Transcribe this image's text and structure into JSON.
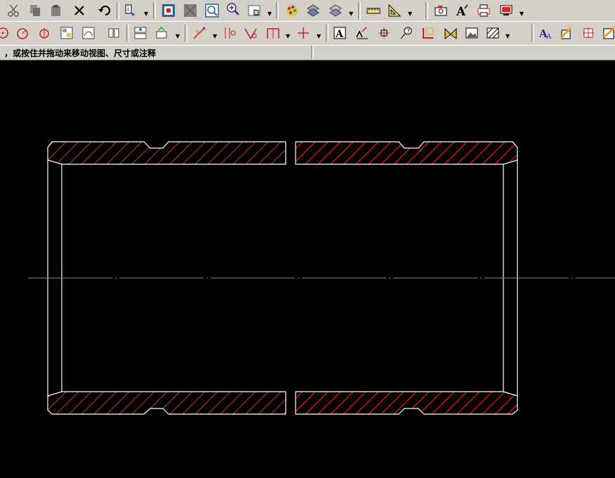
{
  "status_bar": {
    "prompt": "，或按住并拖动来移动视图、尺寸或注释"
  },
  "toolbar_top": {
    "buttons": [
      {
        "name": "cut-button",
        "icon": "scissors-icon"
      },
      {
        "name": "copy-button",
        "icon": "copy-icon"
      },
      {
        "name": "paste-button",
        "icon": "paste-icon"
      },
      {
        "name": "delete-button",
        "icon": "delete-x-icon"
      },
      {
        "name": "undo-button",
        "icon": "undo-arrow-icon"
      },
      {
        "name": "properties-button",
        "icon": "info-icon"
      },
      {
        "name": "zoom-fit-button",
        "icon": "zoom-fit-icon"
      },
      {
        "name": "zoom-window-button",
        "icon": "zoom-window-icon"
      },
      {
        "name": "zoom-box-button",
        "icon": "zoom-box-icon"
      },
      {
        "name": "zoom-inout-button",
        "icon": "magnifier-icon"
      },
      {
        "name": "pan-button",
        "icon": "pan-hand-icon"
      },
      {
        "name": "render-button",
        "icon": "palette-icon"
      },
      {
        "name": "layers-button",
        "icon": "layers-icon"
      },
      {
        "name": "layers-more-button",
        "icon": "layers-alt-icon"
      },
      {
        "name": "measure-button",
        "icon": "ruler-icon"
      },
      {
        "name": "triangle-ruler-button",
        "icon": "set-square-icon"
      },
      {
        "name": "snapshot-button",
        "icon": "camera-icon"
      },
      {
        "name": "text-style-button",
        "icon": "text-a-icon"
      },
      {
        "name": "printer-button",
        "icon": "printer-icon"
      },
      {
        "name": "display-button",
        "icon": "monitor-icon"
      }
    ]
  },
  "toolbar_bottom": {
    "buttons": [
      {
        "name": "circle-tool-button",
        "icon": "circle-arrow-icon"
      },
      {
        "name": "arc-tool-button",
        "icon": "arc-circle-icon"
      },
      {
        "name": "center-circle-button",
        "icon": "center-circle-icon"
      },
      {
        "name": "view-insert-button",
        "icon": "view-grid-icon"
      },
      {
        "name": "detail-view-button",
        "icon": "detail-view-icon"
      },
      {
        "name": "section-view-button",
        "icon": "section-view-icon"
      },
      {
        "name": "break-view-button",
        "icon": "break-view-icon"
      },
      {
        "name": "align-view-button",
        "icon": "align-view-icon"
      },
      {
        "name": "smart-dimension-button",
        "icon": "dimension-arrow-icon"
      },
      {
        "name": "ordinate-dimension-button",
        "icon": "ordinate-icon"
      },
      {
        "name": "angle-dimension-button",
        "icon": "angle-icon"
      },
      {
        "name": "chamfer-dimension-button",
        "icon": "chamfer-icon"
      },
      {
        "name": "centerline-button",
        "icon": "centerline-icon"
      },
      {
        "name": "note-button",
        "icon": "note-a-icon"
      },
      {
        "name": "surface-finish-button",
        "icon": "surface-finish-icon"
      },
      {
        "name": "datum-button",
        "icon": "datum-icon"
      },
      {
        "name": "balloon-button",
        "icon": "balloon-icon"
      },
      {
        "name": "geometric-tolerance-button",
        "icon": "gtol-icon"
      },
      {
        "name": "weld-symbol-button",
        "icon": "weld-icon"
      },
      {
        "name": "image-button",
        "icon": "image-icon"
      },
      {
        "name": "hatch-button",
        "icon": "hatch-icon"
      },
      {
        "name": "text-format-button",
        "icon": "text-format-icon"
      },
      {
        "name": "design-table-button",
        "icon": "pencil-table-icon"
      },
      {
        "name": "block-button",
        "icon": "block-icon"
      },
      {
        "name": "more-tools-button",
        "icon": "more-icon"
      }
    ]
  },
  "drawing": {
    "title": "",
    "part": "tube-section-view",
    "line_color": "#ffffff",
    "hatch_color": "#ff2020",
    "centerline_color": "#c87070",
    "background_color": "#000000"
  }
}
